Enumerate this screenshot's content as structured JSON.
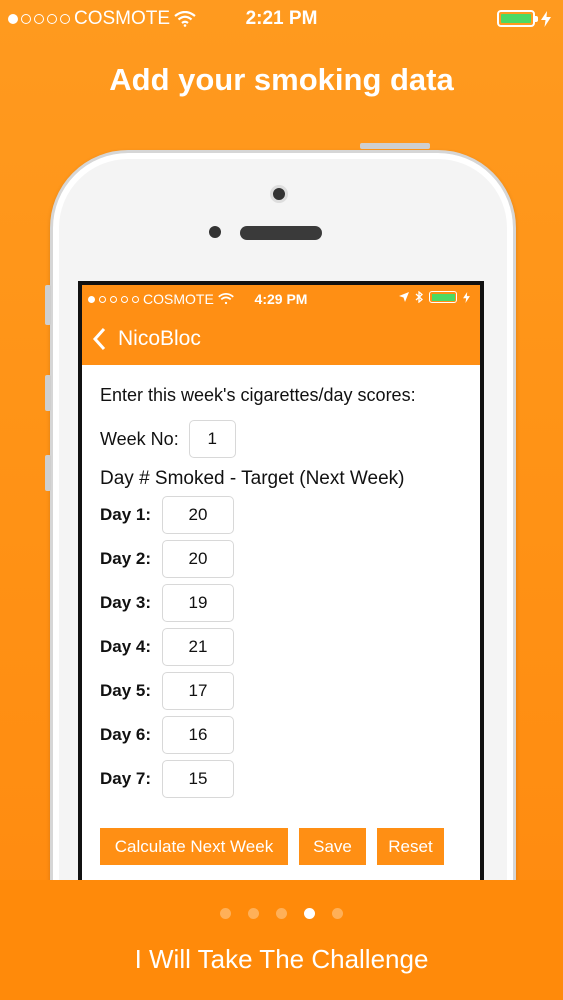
{
  "status_bar": {
    "carrier": "COSMOTE",
    "time": "2:21 PM",
    "battery_color": "#4cd964"
  },
  "headline": "Add your smoking data",
  "device_screen": {
    "status_bar": {
      "carrier": "COSMOTE",
      "time": "4:29 PM"
    },
    "nav": {
      "back_label": "NicoBloc"
    },
    "intro": "Enter this week's cigarettes/day scores:",
    "week_label": "Week No:",
    "week_value": "1",
    "column_header": "Day # Smoked - Target (Next Week)",
    "days": [
      {
        "label": "Day 1:",
        "value": "20"
      },
      {
        "label": "Day 2:",
        "value": "20"
      },
      {
        "label": "Day 3:",
        "value": "19"
      },
      {
        "label": "Day 4:",
        "value": "21"
      },
      {
        "label": "Day 5:",
        "value": "17"
      },
      {
        "label": "Day 6:",
        "value": "16"
      },
      {
        "label": "Day 7:",
        "value": "15"
      }
    ],
    "buttons": {
      "calculate": "Calculate Next Week",
      "save": "Save",
      "reset": "Reset"
    }
  },
  "pager": {
    "count": 5,
    "active_index": 3
  },
  "cta": "I Will Take The Challenge",
  "colors": {
    "accent": "#ff8f14",
    "background": "#ff9316"
  }
}
